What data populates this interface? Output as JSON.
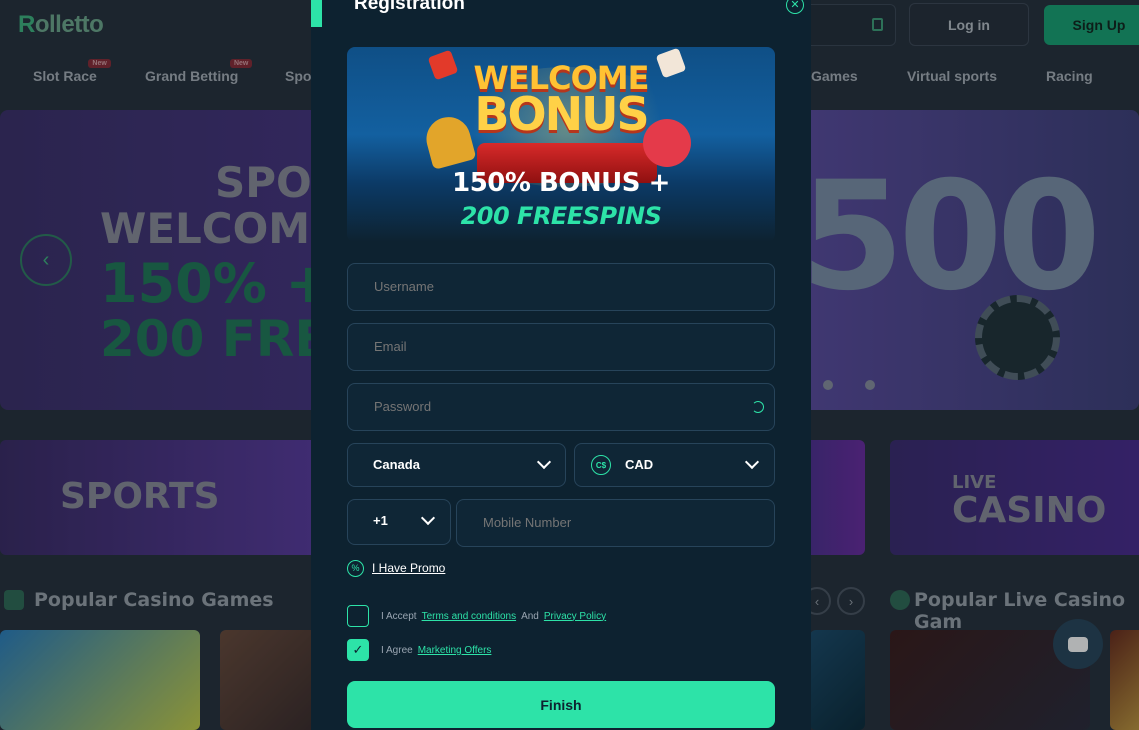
{
  "header": {
    "logo": "olletto",
    "logo_initial": "R",
    "login_label": "Log in",
    "signup_label": "Sign Up"
  },
  "nav": {
    "items": [
      {
        "label": "Slot Race",
        "badge": "New"
      },
      {
        "label": "Grand Betting",
        "badge": "New"
      },
      {
        "label": "Spo"
      },
      {
        "label": "Games"
      },
      {
        "label": "Virtual sports"
      },
      {
        "label": "Racing"
      }
    ]
  },
  "hero": {
    "line1": "SPO",
    "line2": "WELCOME",
    "line3": "150% +",
    "line4": "200 FRE",
    "big_number": "500"
  },
  "categories": {
    "sports": "SPORTS",
    "live_small": "LIVE",
    "live_big": "CASINO"
  },
  "sections": {
    "popular_casino": "Popular Casino Games",
    "popular_live": "Popular Live Casino Gam"
  },
  "modal": {
    "title": "Registration",
    "banner": {
      "welcome": "WELCOME",
      "bonus": "BONUS",
      "line1": "150% BONUS +",
      "line2": "200 FREESPINS"
    },
    "fields": {
      "username_placeholder": "Username",
      "email_placeholder": "Email",
      "password_placeholder": "Password",
      "mobile_placeholder": "Mobile Number"
    },
    "country": "Canada",
    "currency_symbol": "C$",
    "currency": "CAD",
    "phone_code": "+1",
    "promo_label": "I Have Promo",
    "terms": {
      "prefix": "I Accept",
      "terms_link": "Terms and conditions",
      "and": "And",
      "privacy_link": "Privacy Policy",
      "checked": false
    },
    "marketing": {
      "prefix": "I Agree",
      "link": "Marketing Offers",
      "checked": true
    },
    "finish_label": "Finish",
    "accent_color": "#2de3a8"
  }
}
